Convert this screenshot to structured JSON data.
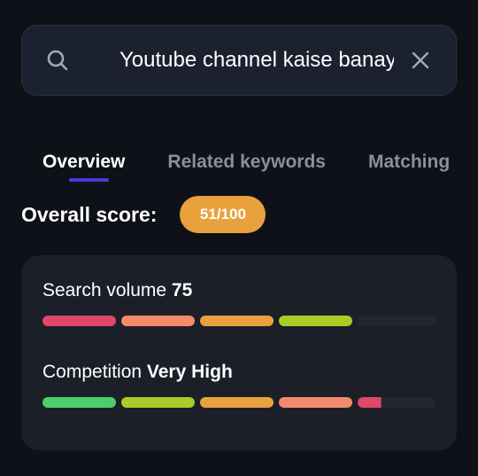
{
  "search": {
    "value": "Youtube channel kaise banaye",
    "icon": "search-icon",
    "clear_icon": "close-icon"
  },
  "tabs": [
    {
      "label": "Overview",
      "active": true
    },
    {
      "label": "Related keywords",
      "active": false
    },
    {
      "label": "Matching",
      "active": false
    }
  ],
  "overall": {
    "label": "Overall score:",
    "score": "51/100",
    "badge_color": "#e8a13c"
  },
  "metrics": [
    {
      "label": "Search volume",
      "value": "75",
      "filled_segments": 4,
      "total_segments": 5,
      "segment_colors": [
        "#e0476b",
        "#f38a6b",
        "#e8a13c",
        "#a9cc26",
        "#222633"
      ]
    },
    {
      "label": "Competition",
      "value": "Very High",
      "filled_segments": 4.3,
      "total_segments": 5,
      "segment_colors": [
        "#4ccf6a",
        "#a9cc26",
        "#e8a13c",
        "#f38a6b",
        "#e0476b"
      ]
    }
  ],
  "colors": {
    "background": "#0f1118",
    "card": "#1c1f28",
    "search_bg": "#1c2130",
    "accent_underline": "#4b3ad6",
    "inactive_tab": "#8a8f9c"
  }
}
